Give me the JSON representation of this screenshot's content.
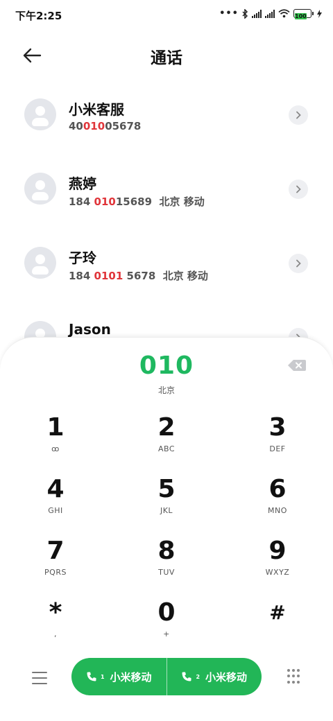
{
  "status_bar": {
    "time": "下午2:25",
    "dots": "•••",
    "battery_level": "100"
  },
  "header": {
    "title": "通话"
  },
  "contacts": [
    {
      "name": "小米客服",
      "number_pre": "40",
      "number_hl": "010",
      "number_post": "05678"
    },
    {
      "name": "燕婷",
      "number_pre": "184 ",
      "number_hl": "010",
      "number_post": "15689  北京 移动"
    },
    {
      "name": "子玲",
      "number_pre": "184 ",
      "number_hl": "0101",
      "number_post": " 5678  北京 移动"
    },
    {
      "name": "Jason",
      "number_pre": "",
      "number_hl": "",
      "number_post": ""
    }
  ],
  "dialer": {
    "number": "010",
    "location": "北京",
    "keys": [
      {
        "digit": "1",
        "letters": "ꝏ"
      },
      {
        "digit": "2",
        "letters": "ABC"
      },
      {
        "digit": "3",
        "letters": "DEF"
      },
      {
        "digit": "4",
        "letters": "GHI"
      },
      {
        "digit": "5",
        "letters": "JKL"
      },
      {
        "digit": "6",
        "letters": "MNO"
      },
      {
        "digit": "7",
        "letters": "PQRS"
      },
      {
        "digit": "8",
        "letters": "TUV"
      },
      {
        "digit": "9",
        "letters": "WXYZ"
      },
      {
        "digit": "*",
        "letters": ","
      },
      {
        "digit": "0",
        "letters": "+"
      },
      {
        "digit": "#",
        "letters": ""
      }
    ]
  },
  "bottom_bar": {
    "call_sim1_label": "小米移动",
    "call_sim1_index": "1",
    "call_sim2_label": "小米移动",
    "call_sim2_index": "2"
  },
  "colors": {
    "accent_green": "#22b657",
    "dialed_green": "#1fb860",
    "highlight_red": "#e0353a"
  }
}
